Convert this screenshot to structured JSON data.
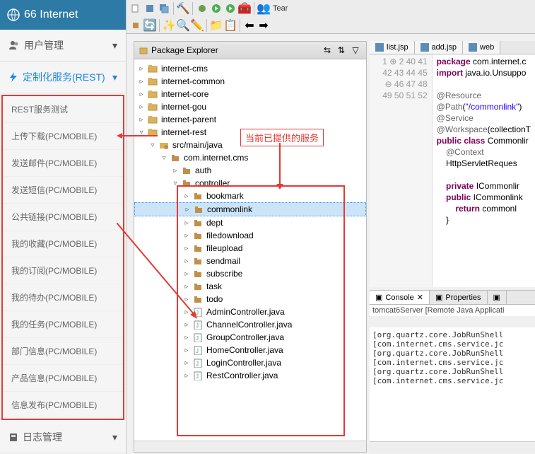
{
  "brand": {
    "title": "66 Internet"
  },
  "nav": {
    "user_mgmt": "用户管理",
    "custom_svc": "定制化服务(REST)",
    "log_mgmt": "日志管理"
  },
  "menu_items": [
    "REST服务测试",
    "上传下载(PC/MOBILE)",
    "发送邮件(PC/MOBILE)",
    "发送短信(PC/MOBILE)",
    "公共链接(PC/MOBILE)",
    "我的收藏(PC/MOBILE)",
    "我的订阅(PC/MOBILE)",
    "我的待办(PC/MOBILE)",
    "我的任务(PC/MOBILE)",
    "部门信息(PC/MOBILE)",
    "产品信息(PC/MOBILE)",
    "信息发布(PC/MOBILE)"
  ],
  "toolbar_right": {
    "team": "Tear"
  },
  "explorer": {
    "title": "Package Explorer",
    "projects": [
      "internet-cms",
      "internet-common",
      "internet-core",
      "internet-gou",
      "internet-parent"
    ],
    "rest_project": "internet-rest",
    "src_folder": "src/main/java",
    "pkg": "com.internet.cms",
    "auth_pkg": "auth",
    "controller_pkg": "controller",
    "controller_items": [
      "bookmark",
      "commonlink",
      "dept",
      "filedownload",
      "fileupload",
      "sendmail",
      "subscribe",
      "task",
      "todo"
    ],
    "controller_java": [
      "AdminController.java",
      "ChannelController.java",
      "GroupController.java",
      "HomeController.java",
      "LoginController.java",
      "RestController.java"
    ]
  },
  "annotation": {
    "provided": "当前已提供的服务"
  },
  "editor": {
    "tabs": [
      "list.jsp",
      "add.jsp",
      "web"
    ],
    "lines": [
      {
        "n": "1",
        "html": "<span class='kw'>package</span> com.internet.c"
      },
      {
        "n": "2",
        "html": "<span class='kw'>import</span> java.io.Unsuppo",
        "marker": "⊕"
      },
      {
        "n": "40",
        "html": ""
      },
      {
        "n": "41",
        "html": "<span class='ann'>@Resource</span>"
      },
      {
        "n": "42",
        "html": "<span class='ann'>@Path</span>(<span class='str'>\"/commonlink\"</span>)"
      },
      {
        "n": "43",
        "html": "<span class='ann'>@Service</span>"
      },
      {
        "n": "44",
        "html": "<span class='ann'>@Workspace</span>(collectionT"
      },
      {
        "n": "45",
        "html": "<span class='kw'>public class</span> Commonlir"
      },
      {
        "n": "46",
        "html": "    <span class='ann'>@Context</span>",
        "marker": "⊖"
      },
      {
        "n": "47",
        "html": "    HttpServletReques"
      },
      {
        "n": "48",
        "html": ""
      },
      {
        "n": "49",
        "html": "    <span class='kw'>private</span> ICommonlir"
      },
      {
        "n": "50",
        "html": "    <span class='kw'>public</span> ICommonlink"
      },
      {
        "n": "51",
        "html": "        <span class='kw'>return</span> commonl"
      },
      {
        "n": "52",
        "html": "    }"
      }
    ]
  },
  "console": {
    "tabs": [
      "Console",
      "Properties"
    ],
    "desc": "tomcat6Server [Remote Java Applicati",
    "lines": [
      "[org.quartz.core.JobRunShell",
      "[com.internet.cms.service.jc",
      "[org.quartz.core.JobRunShell",
      "[com.internet.cms.service.jc",
      "[org.quartz.core.JobRunShell",
      "[com.internet.cms.service.jc"
    ]
  }
}
